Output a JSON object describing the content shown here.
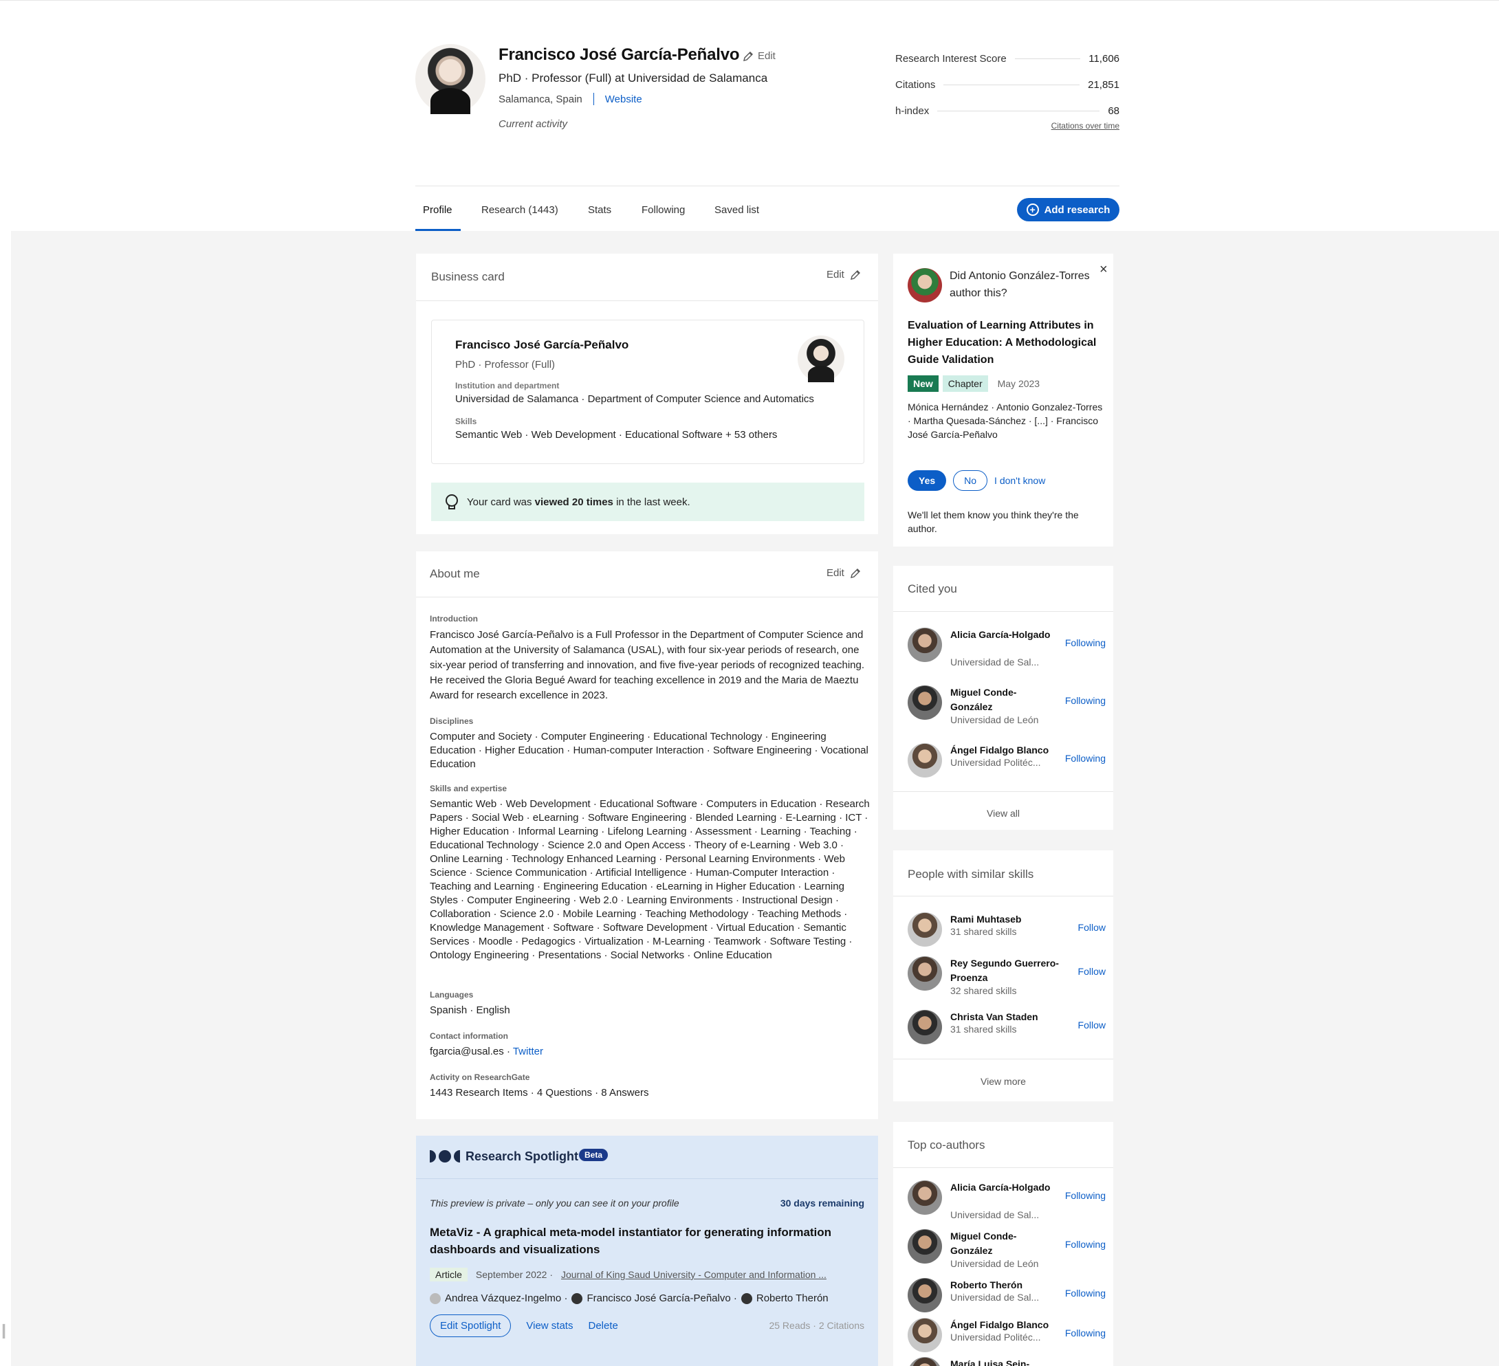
{
  "profile": {
    "name": "Francisco José García-Peñalvo",
    "edit_label": "Edit",
    "headline": "PhD · Professor (Full) at Universidad de Salamanca",
    "location": "Salamanca, Spain",
    "website_label": "Website",
    "activity": "Current activity"
  },
  "stats": {
    "rows": [
      {
        "label": "Research Interest Score",
        "value": "11,606"
      },
      {
        "label": "Citations",
        "value": "21,851"
      },
      {
        "label": "h-index",
        "value": "68"
      }
    ],
    "link": "Citations over time"
  },
  "tabs": [
    {
      "label": "Profile"
    },
    {
      "label": "Research (1443)"
    },
    {
      "label": "Stats"
    },
    {
      "label": "Following"
    },
    {
      "label": "Saved list"
    }
  ],
  "add_research": "Add research",
  "business_card": {
    "title": "Business card",
    "edit": "Edit",
    "name": "Francisco José García-Peñalvo",
    "role": "PhD · Professor (Full)",
    "inst_label": "Institution and department",
    "inst": "Universidad de Salamanca · Department of Computer Science and Automatics",
    "skills_label": "Skills",
    "skills": "Semantic Web · Web Development · Educational Software + 53 others",
    "banner_pre": "Your card was ",
    "banner_bold": "viewed 20 times",
    "banner_post": " in the last week."
  },
  "about": {
    "title": "About me",
    "edit": "Edit",
    "intro_label": "Introduction",
    "intro": "Francisco José García-Peñalvo is a Full Professor in the Department of Computer Science and Automation at the University of Salamanca (USAL), with four six-year periods of research, one six-year period of transferring and innovation, and five five-year periods of recognized teaching. He received the Gloria Begué Award for teaching excellence in 2019 and the Maria de Maeztu Award for research excellence in 2023.",
    "disc_label": "Disciplines",
    "disc": "Computer and Society · Computer Engineering · Educational Technology · Engineering Education · Higher Education · Human-computer Interaction · Software Engineering · Vocational Education",
    "skills_label": "Skills and expertise",
    "skills": "Semantic Web · Web Development · Educational Software · Computers in Education · Research Papers · Social Web · eLearning · Software Engineering · Blended Learning · E-Learning · ICT · Higher Education · Informal Learning · Lifelong Learning · Assessment · Learning · Teaching · Educational Technology · Science 2.0 and Open Access · Theory of e-Learning · Web 3.0 · Online Learning · Technology Enhanced Learning · Personal Learning Environments · Web Science · Science Communication · Artificial Intelligence · Human-Computer Interaction · Teaching and Learning · Engineering Education · eLearning in Higher Education · Learning Styles · Computer Engineering · Web 2.0 · Learning Environments · Instructional Design · Collaboration · Science 2.0 · Mobile Learning · Teaching Methodology · Teaching Methods · Knowledge Management · Software · Software Development · Virtual Education · Semantic Services · Moodle · Pedagogics · Virtualization · M-Learning · Teamwork · Software Testing · Ontology Engineering · Presentations · Social Networks · Online Education",
    "lang_label": "Languages",
    "lang": "Spanish · English",
    "contact_label": "Contact information",
    "contact_email": "fgarcia@usal.es · ",
    "contact_twitter": "Twitter",
    "activity_label": "Activity on ResearchGate",
    "activity": "1443 Research Items · 4 Questions · 8 Answers"
  },
  "spotlight": {
    "title": "Research Spotlight",
    "beta": "Beta",
    "note": "This preview is private – only you can see it on your profile",
    "days": "30 days remaining",
    "pub_title": "MetaViz - A graphical meta-model instantiator for generating information dashboards and visualizations",
    "type": "Article",
    "date": "September 2022 ·",
    "journal": "Journal of King Saud University - Computer and Information ...",
    "author1": "Andrea Vázquez-Ingelmo ·",
    "author2": "Francisco José García-Peñalvo ·",
    "author3": "Roberto Therón",
    "edit": "Edit Spotlight",
    "view_stats": "View stats",
    "delete": "Delete",
    "counts": "25 Reads · 2 Citations"
  },
  "ask": {
    "question": "Did Antonio González-Torres author this?",
    "pub_title": "Evaluation of Learning Attributes in Higher Education: A Methodological Guide Validation",
    "tag_new": "New",
    "tag_type": "Chapter",
    "date": "May 2023",
    "authors": "Mónica Hernández · Antonio Gonzalez-Torres · Martha Quesada-Sánchez · [...] · Francisco José García-Peñalvo",
    "yes": "Yes",
    "no": "No",
    "dont_know": "I don't know",
    "foot": "We'll let them know you think they're the author."
  },
  "cited": {
    "title": "Cited you",
    "people": [
      {
        "name": "Alicia García-Holgado",
        "sub": "Universidad de Sal...",
        "action": "Following"
      },
      {
        "name": "Miguel Conde-González",
        "sub": "Universidad de León",
        "action": "Following"
      },
      {
        "name": "Ángel Fidalgo Blanco",
        "sub": "Universidad Politéc...",
        "action": "Following"
      }
    ],
    "view_all": "View all"
  },
  "similar": {
    "title": "People with similar skills",
    "people": [
      {
        "name": "Rami Muhtaseb",
        "sub": "31 shared skills",
        "action": "Follow"
      },
      {
        "name": "Rey Segundo Guerrero-Proenza",
        "sub": "32 shared skills",
        "action": "Follow"
      },
      {
        "name": "Christa Van Staden",
        "sub": "31 shared skills",
        "action": "Follow"
      }
    ],
    "view_more": "View more"
  },
  "coauthors": {
    "title": "Top co-authors",
    "people": [
      {
        "name": "Alicia García-Holgado",
        "sub": "Universidad de Sal...",
        "action": "Following"
      },
      {
        "name": "Miguel Conde-González",
        "sub": "Universidad de León",
        "action": "Following"
      },
      {
        "name": "Roberto Therón",
        "sub": "Universidad de Sal...",
        "action": "Following"
      },
      {
        "name": "Ángel Fidalgo Blanco",
        "sub": "Universidad Politéc...",
        "action": "Following"
      },
      {
        "name": "María Luisa Sein-",
        "sub": "",
        "action": ""
      }
    ]
  }
}
